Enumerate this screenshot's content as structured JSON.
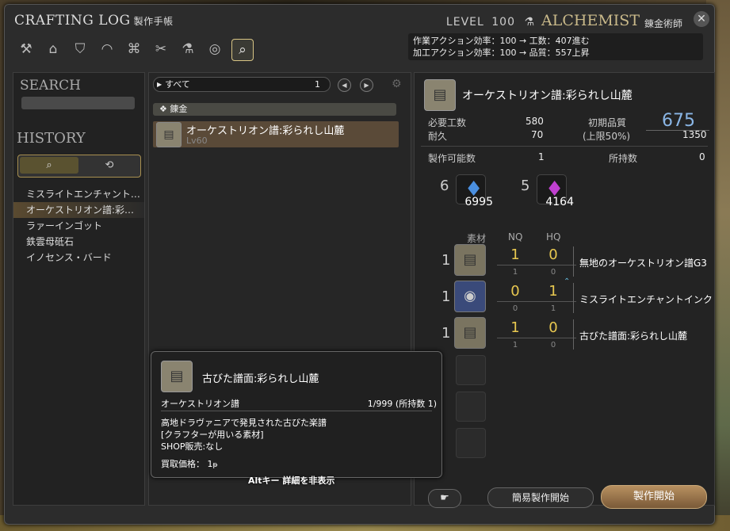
{
  "window": {
    "title": "CRAFTING LOG",
    "title_jp": "製作手帳",
    "close_glyph": "✕",
    "level_label": "LEVEL",
    "level_value": "100",
    "class_name": "ALCHEMIST",
    "class_name_jp": "錬金術師",
    "efficiency_line1": "作業アクション効率：100 → 工数：407進む",
    "efficiency_line2": "加工アクション効率：100 → 品質：557上昇"
  },
  "toolbar": {
    "icons": [
      "carpenter-icon",
      "blacksmith-icon",
      "armorer-icon",
      "goldsmith-icon",
      "leatherworker-icon",
      "weaver-icon",
      "alchemist-icon",
      "culinarian-icon",
      "search-icon"
    ],
    "active": "search-icon"
  },
  "left_panel": {
    "search_heading": "SEARCH",
    "search_placeholder": "",
    "history_heading": "HISTORY",
    "history_items": [
      "ミスライトエンチャント…",
      "オーケストリオン譜:彩…",
      "ラァーインゴット",
      "鉄雲母砥石",
      "イノセンス・バード"
    ],
    "selected_index": 1
  },
  "middle_panel": {
    "filter_label": "すべて",
    "filter_count": "1",
    "category_label": "錬金",
    "recipe_name": "オーケストリオン譜:彩られし山麓",
    "recipe_level": "Lv60"
  },
  "right_panel": {
    "item_name": "オーケストリオン譜:彩られし山麓",
    "required_progress_label": "必要工数",
    "required_progress_value": "580",
    "durability_label": "耐久",
    "durability_value": "70",
    "initial_quality_label": "初期品質",
    "initial_quality_value": "675",
    "cap_label": "(上限50%)",
    "cap_value": "1350",
    "craftable_label": "製作可能数",
    "craftable_value": "1",
    "owned_label": "所持数",
    "owned_value": "0",
    "crystals": [
      {
        "required": "6",
        "owned": "6995",
        "color": "#4a8fe0",
        "icon": "water-crystal-icon"
      },
      {
        "required": "5",
        "owned": "4164",
        "color": "#c040d0",
        "icon": "lightning-crystal-icon"
      }
    ],
    "materials_header": "素材",
    "nq_header": "NQ",
    "hq_header": "HQ",
    "materials": [
      {
        "qty": "1",
        "nq": "1",
        "hq": "0",
        "nq_have": "1",
        "hq_have": "0",
        "name": "無地のオーケストリオン譜G3",
        "hq_mark": false
      },
      {
        "qty": "1",
        "nq": "0",
        "hq": "1",
        "nq_have": "0",
        "hq_have": "1",
        "name": "ミスライトエンチャントインク",
        "hq_mark": true
      },
      {
        "qty": "1",
        "nq": "1",
        "hq": "0",
        "nq_have": "1",
        "hq_have": "0",
        "name": "古びた譜面:彩られし山麓",
        "hq_mark": false
      }
    ],
    "quick_synth_button": "簡易製作開始",
    "synth_button": "製作開始"
  },
  "tooltip": {
    "name": "古びた譜面:彩られし山麓",
    "type": "オーケストリオン譜",
    "stack": "1/999 (所持数 1)",
    "desc1": "高地ドラヴァニアで発見された古びた楽譜",
    "desc2": "[クラフターが用いる素材]",
    "desc3": "SHOP販売:なし",
    "price": "買取価格： 1",
    "price_icon": "gil-icon"
  },
  "hint": {
    "alt": "Altキー 詳細を非表示"
  }
}
